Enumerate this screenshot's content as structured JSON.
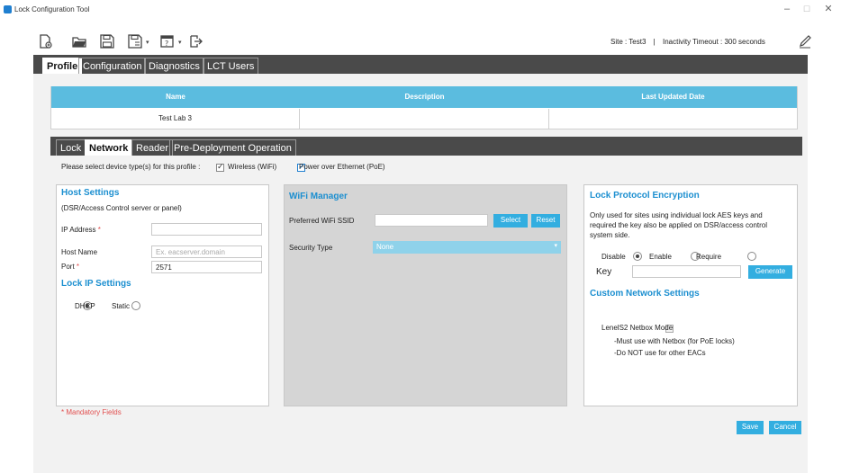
{
  "app": {
    "title": "Lock Configuration Tool"
  },
  "window": {
    "minimize": "–",
    "maximize": "☐",
    "close": "✕"
  },
  "toolbar": {
    "icons": [
      "new-file-icon",
      "open-folder-icon",
      "save-icon",
      "save-as-icon",
      "report-icon",
      "export-icon",
      "edit-pencil-icon"
    ],
    "site_label": "Site : Test3",
    "separator": "|",
    "timeout_label": "Inactivity Timeout : 300 seconds"
  },
  "main_tabs": [
    {
      "label": "Profile",
      "active": true
    },
    {
      "label": "Configuration",
      "active": false
    },
    {
      "label": "Diagnostics",
      "active": false
    },
    {
      "label": "LCT Users",
      "active": false
    }
  ],
  "profile_table": {
    "headers": [
      "Name",
      "Description",
      "Last Updated Date"
    ],
    "rows": [
      [
        "Test Lab 3",
        "",
        ""
      ]
    ]
  },
  "sub_tabs": [
    {
      "label": "Lock",
      "active": false
    },
    {
      "label": "Network",
      "active": true
    },
    {
      "label": "Reader",
      "active": false
    },
    {
      "label": "Pre-Deployment Operation",
      "active": false
    }
  ],
  "device_types": {
    "prompt": "Please select device type(s) for this profile :",
    "wifi_label": "Wireless (WiFi)",
    "wifi_checked": true,
    "poe_label": "Power over Ethernet (PoE)",
    "poe_checked": true
  },
  "host_settings": {
    "title": "Host Settings",
    "subtitle": "(DSR/Access Control server or panel)",
    "ip_label": "IP Address",
    "ip_required": "*",
    "ip_value": "",
    "host_label": "Host Name",
    "host_placeholder": "Ex. eacserver.domain",
    "port_label": "Port",
    "port_required": "*",
    "port_value": "2571"
  },
  "lock_ip": {
    "title": "Lock IP Settings",
    "dhcp_label": "DHCP",
    "static_label": "Static",
    "selected": "DHCP"
  },
  "mandatory_note": "* Mandatory Fields",
  "wifi_manager": {
    "title": "WiFi Manager",
    "ssid_label": "Preferred WiFi SSID",
    "ssid_value": "",
    "select_button": "Select",
    "reset_button": "Reset",
    "security_label": "Security Type",
    "security_value": "None"
  },
  "encryption": {
    "title": "Lock Protocol Encryption",
    "desc_1": "Only used for sites using individual lock AES keys and",
    "desc_2": "required the key also be applied on DSR/access control",
    "desc_3": "system side.",
    "disable_label": "Disable",
    "enable_label": "Enable",
    "require_label": "Require",
    "selected": "Disable",
    "key_label": "Key",
    "key_value": "",
    "generate_button": "Generate"
  },
  "custom_network": {
    "title": "Custom Network Settings",
    "netbox_label": "LenelS2 Netbox Mode",
    "netbox_checked": false,
    "note_1": "-Must use with Netbox (for PoE locks)",
    "note_2": "-Do NOT use for other EACs"
  },
  "footer": {
    "save_button": "Save",
    "cancel_button": "Cancel"
  },
  "colors": {
    "accent": "#33aee0",
    "header_blue": "#5bbcdf",
    "title_blue": "#1c8fd0",
    "dark_bar": "#4a4a4a",
    "required_red": "#e25050"
  }
}
